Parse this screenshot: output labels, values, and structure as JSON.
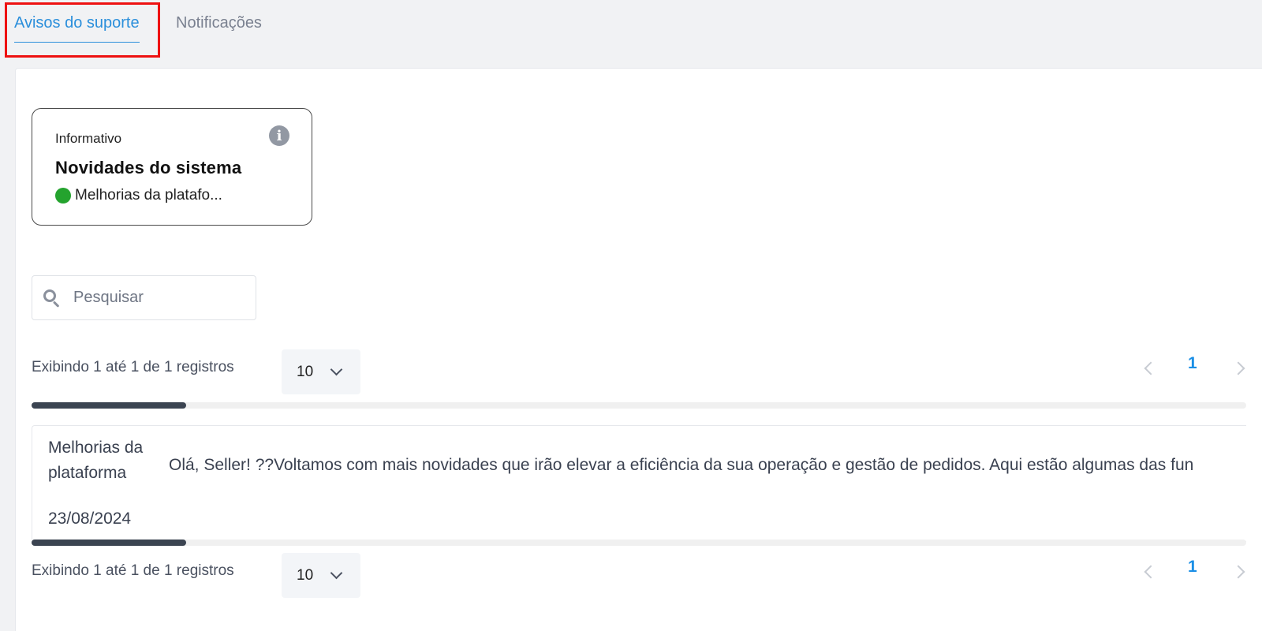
{
  "tabs": [
    {
      "label": "Avisos do suporte",
      "active": true
    },
    {
      "label": "Notificações",
      "active": false
    }
  ],
  "info_card": {
    "category": "Informativo",
    "title": "Novidades do sistema",
    "status_text": "Melhorias da platafo...",
    "status_color": "#24a32e",
    "icon": "info-icon"
  },
  "search": {
    "placeholder": "Pesquisar",
    "value": "",
    "icon": "search-icon"
  },
  "pagination_top": {
    "records_text": "Exibindo 1 até 1 de 1 registros",
    "page_size": "10",
    "current_page": "1"
  },
  "pagination_bottom": {
    "records_text": "Exibindo 1 até 1 de 1 registros",
    "page_size": "10",
    "current_page": "1"
  },
  "items": [
    {
      "title": "Melhorias da plataforma",
      "date": "23/08/2024",
      "description": "Olá, Seller! ??Voltamos com mais novidades que irão elevar a eficiência da sua operação e gestão de pedidos. Aqui estão algumas das fun"
    }
  ],
  "colors": {
    "accent": "#2b8fdb",
    "page_link": "#1b8fe6",
    "highlight": "#ee1111"
  }
}
